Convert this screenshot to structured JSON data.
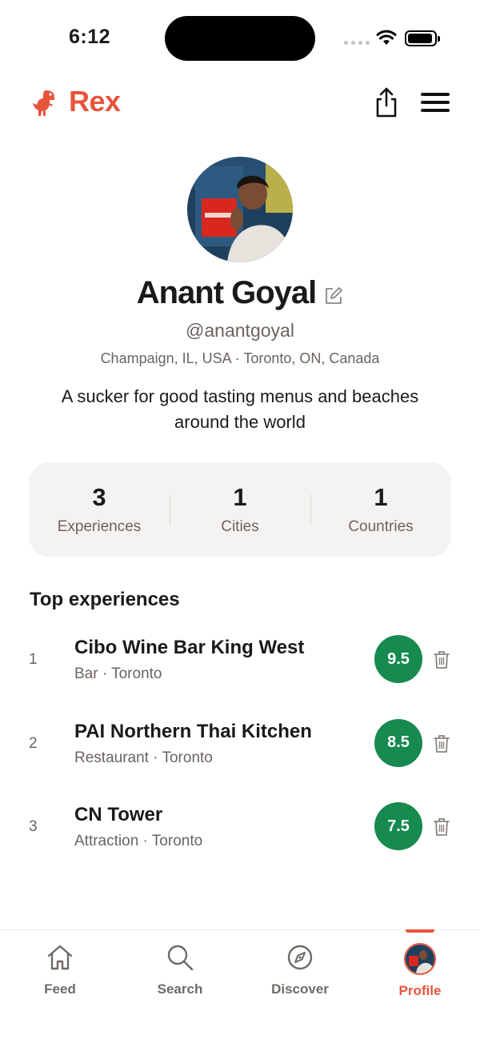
{
  "status_bar": {
    "time": "6:12"
  },
  "header": {
    "app_name": "Rex",
    "logo_icon": "dinosaur-icon",
    "share_icon": "share-icon",
    "menu_icon": "hamburger-menu-icon"
  },
  "profile": {
    "name": "Anant Goyal",
    "handle": "@anantgoyal",
    "locations": "Champaign, IL, USA · Toronto, ON, Canada",
    "bio": "A sucker for good tasting menus and beaches around the world"
  },
  "stats": [
    {
      "value": "3",
      "label": "Experiences"
    },
    {
      "value": "1",
      "label": "Cities"
    },
    {
      "value": "1",
      "label": "Countries"
    }
  ],
  "top_experiences": {
    "title": "Top experiences",
    "items": [
      {
        "rank": "1",
        "name": "Cibo Wine Bar King West",
        "meta": "Bar · Toronto",
        "score": "9.5"
      },
      {
        "rank": "2",
        "name": "PAI Northern Thai Kitchen",
        "meta": "Restaurant · Toronto",
        "score": "8.5"
      },
      {
        "rank": "3",
        "name": "CN Tower",
        "meta": "Attraction · Toronto",
        "score": "7.5"
      }
    ]
  },
  "tabs": [
    {
      "label": "Feed",
      "icon": "home-icon"
    },
    {
      "label": "Search",
      "icon": "search-icon"
    },
    {
      "label": "Discover",
      "icon": "compass-icon"
    },
    {
      "label": "Profile",
      "icon": "avatar",
      "active": true
    }
  ],
  "colors": {
    "brand": "#e8553d",
    "score_green": "#168a4f"
  }
}
